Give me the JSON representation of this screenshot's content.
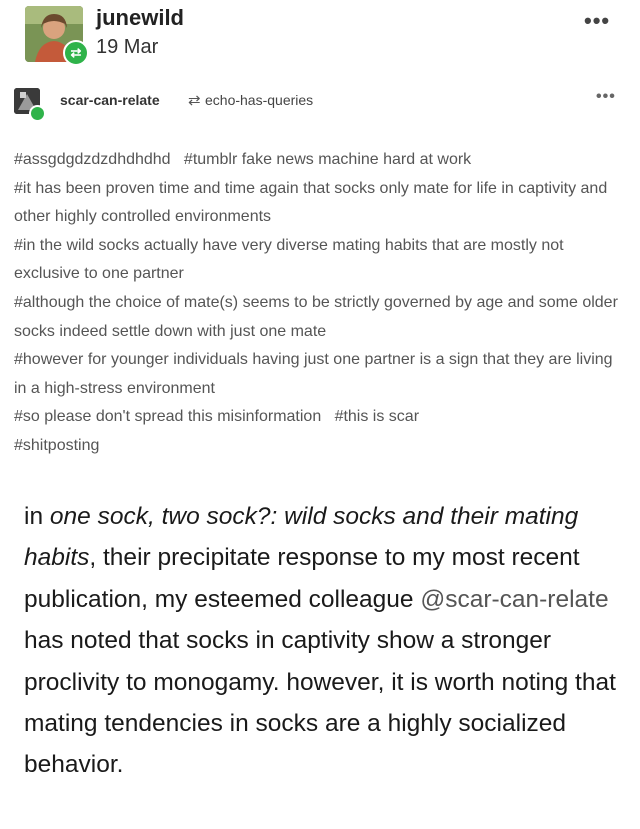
{
  "post": {
    "author": "junewild",
    "date": "19 Mar",
    "menu_icon": "more-dots-icon"
  },
  "reblog": {
    "user": "scar-can-relate",
    "icon": "reblog-icon",
    "source": "echo-has-queries",
    "menu_icon": "more-dots-icon"
  },
  "tags": [
    "#assgdgdzdzdhdhdhd",
    "#tumblr fake news machine hard at work",
    "#it has been proven time and time again that socks only mate for life in captivity and other highly controlled environments",
    "#in the wild socks actually have very diverse mating habits that are mostly not exclusive to one partner",
    "#although the choice of mate(s) seems to be strictly governed by age and some older socks indeed settle down with just one mate",
    "#however for younger individuals having just one partner is a sign that they are living in a high-stress environment",
    "#so please don't spread this misinformation",
    "#this is scar",
    "#shitposting"
  ],
  "body": {
    "intro": "in ",
    "title_italic": "one sock, two sock?: wild socks and their mating habits",
    "after_title": ", their precipitate response to my most recent publication, my esteemed colleague ",
    "mention": "@scar-can-relate",
    "rest": " has noted that socks in captivity show a stronger proclivity to monogamy. however, it is worth noting that mating tendencies in socks are a highly socialized behavior."
  }
}
